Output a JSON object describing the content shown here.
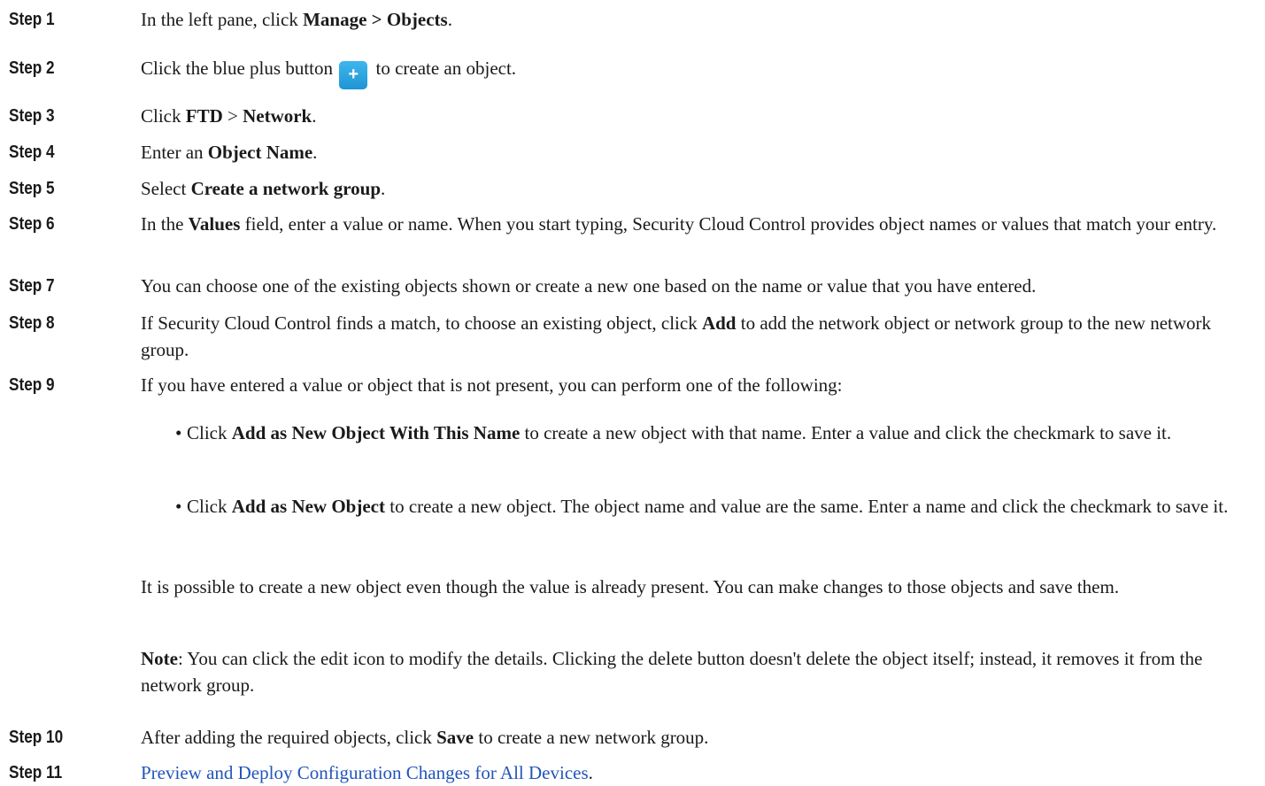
{
  "steps": [
    {
      "label": "Step 1",
      "pre": "In the left pane, click ",
      "b1": "Manage > Objects",
      "post": "."
    },
    {
      "label": "Step 2",
      "pre": "Click the blue plus button",
      "icon": "+",
      "post": "to create an object."
    },
    {
      "label": "Step 3",
      "pre": "Click ",
      "b1": "FTD",
      "mid": " > ",
      "b2": "Network",
      "post": "."
    },
    {
      "label": "Step 4",
      "pre": "Enter an ",
      "b1": "Object Name",
      "post": "."
    },
    {
      "label": "Step 5",
      "pre": "Select ",
      "b1": "Create a network group",
      "post": "."
    },
    {
      "label": "Step 6",
      "pre": "In the ",
      "b1": "Values",
      "post": " field, enter a value or name. When you start typing, Security Cloud Control provides object names or values that match your entry."
    },
    {
      "label": "Step 7",
      "text": "You can choose one of the existing objects shown or create a new one based on the name or value that you have entered."
    },
    {
      "label": "Step 8",
      "pre": "If Security Cloud Control finds a match, to choose an existing object, click ",
      "b1": "Add",
      "post": " to add the network object or network group to the new network group."
    },
    {
      "label": "Step 9",
      "text": "If you have entered a value or object that is not present, you can perform one of the following:"
    },
    {
      "label": "Step 10",
      "pre": "After adding the required objects, click ",
      "b1": "Save",
      "post": " to create a new network group."
    },
    {
      "label": "Step 11",
      "link": "Preview and Deploy Configuration Changes for All Devices",
      "post": "."
    }
  ],
  "bullets": [
    {
      "dot": "•",
      "pre": "Click ",
      "b1": "Add as New Object With This Name",
      "post": " to create a new object with that name. Enter a value and click the checkmark to save it."
    },
    {
      "dot": "•",
      "pre": "Click ",
      "b1": "Add as New Object",
      "post": " to create a new object. The object name and value are the same. Enter a name and click the checkmark to save it."
    }
  ],
  "para_possible": "It is possible to create a new object even though the value is already present. You can make changes to those objects and save them.",
  "note": {
    "label": "Note",
    "text": ": You can click the edit icon to modify the details. Clicking the delete button doesn't delete the object itself; instead, it removes it from the network group."
  },
  "colors": {
    "link": "#2255bb",
    "plus_button": "#2a9fe0"
  }
}
